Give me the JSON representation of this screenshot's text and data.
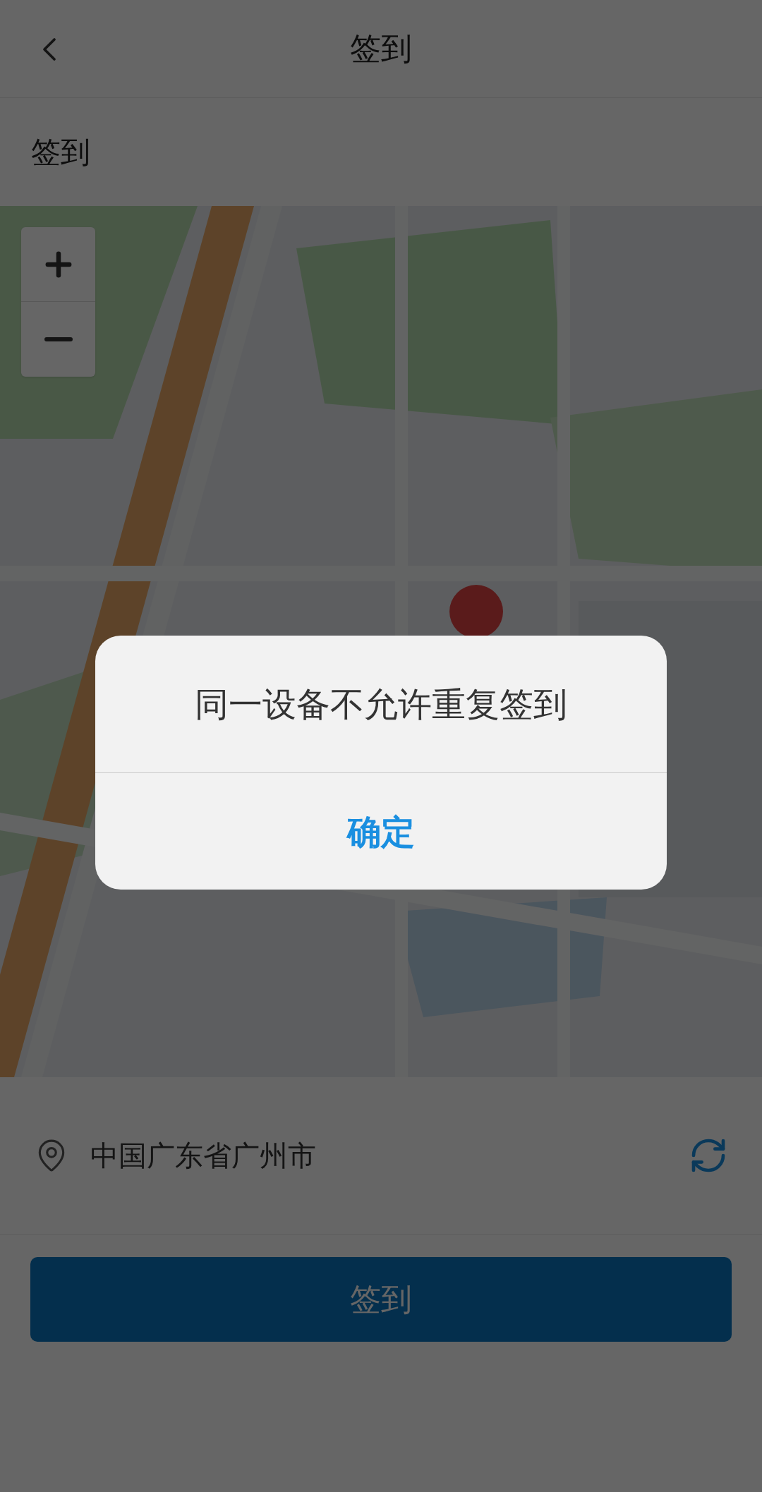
{
  "header": {
    "title": "签到"
  },
  "section": {
    "label": "签到"
  },
  "location": {
    "address": "中国广东省广州市"
  },
  "checkin_button": {
    "label": "签到"
  },
  "dialog": {
    "message": "同一设备不允许重复签到",
    "confirm": "确定"
  }
}
